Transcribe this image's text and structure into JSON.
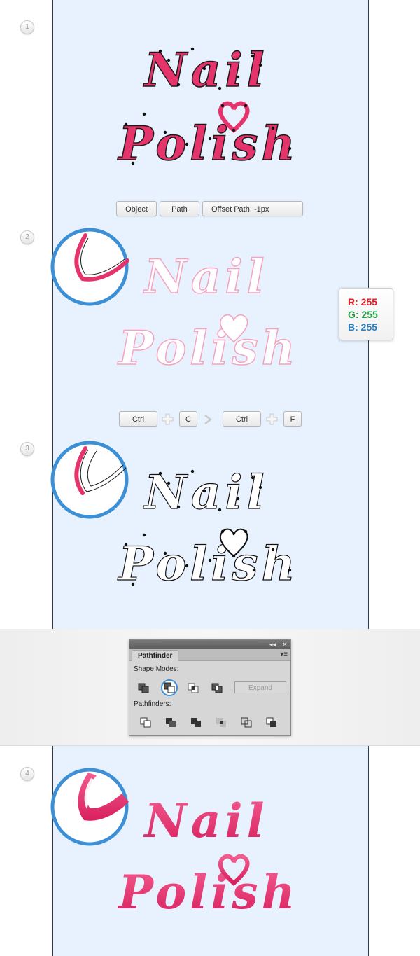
{
  "steps": [
    {
      "number": "1"
    },
    {
      "number": "2"
    },
    {
      "number": "3"
    },
    {
      "number": "4"
    }
  ],
  "lettering": {
    "line1": "Nail",
    "line2": "Polish"
  },
  "menu_path": {
    "item1": "Object",
    "item2": "Path",
    "item3": "Offset Path: -1px"
  },
  "shortcut": {
    "key1": "Ctrl",
    "key2": "C",
    "key3": "Ctrl",
    "key4": "F"
  },
  "color_readout": {
    "r": "R: 255",
    "g": "G: 255",
    "b": "B: 255"
  },
  "pathfinder": {
    "tab": "Pathfinder",
    "shape_modes_label": "Shape Modes:",
    "pathfinders_label": "Pathfinders:",
    "expand_label": "Expand",
    "collapse_glyph": "◂◂",
    "close_glyph": "✕",
    "menu_glyph": "▾≡"
  },
  "colors": {
    "pink": "#e5336b",
    "light_pink": "#f4a3bf",
    "artboard": "#e8f2fe",
    "highlight_ring": "#3d8fd6",
    "red": "#e31b23",
    "green": "#22a04a",
    "blue": "#2a7fc1"
  },
  "icons": [
    "unite-icon",
    "minus-front-icon",
    "intersect-icon",
    "exclude-icon",
    "divide-icon",
    "trim-icon",
    "merge-icon",
    "crop-icon",
    "outline-icon",
    "minus-back-icon"
  ]
}
